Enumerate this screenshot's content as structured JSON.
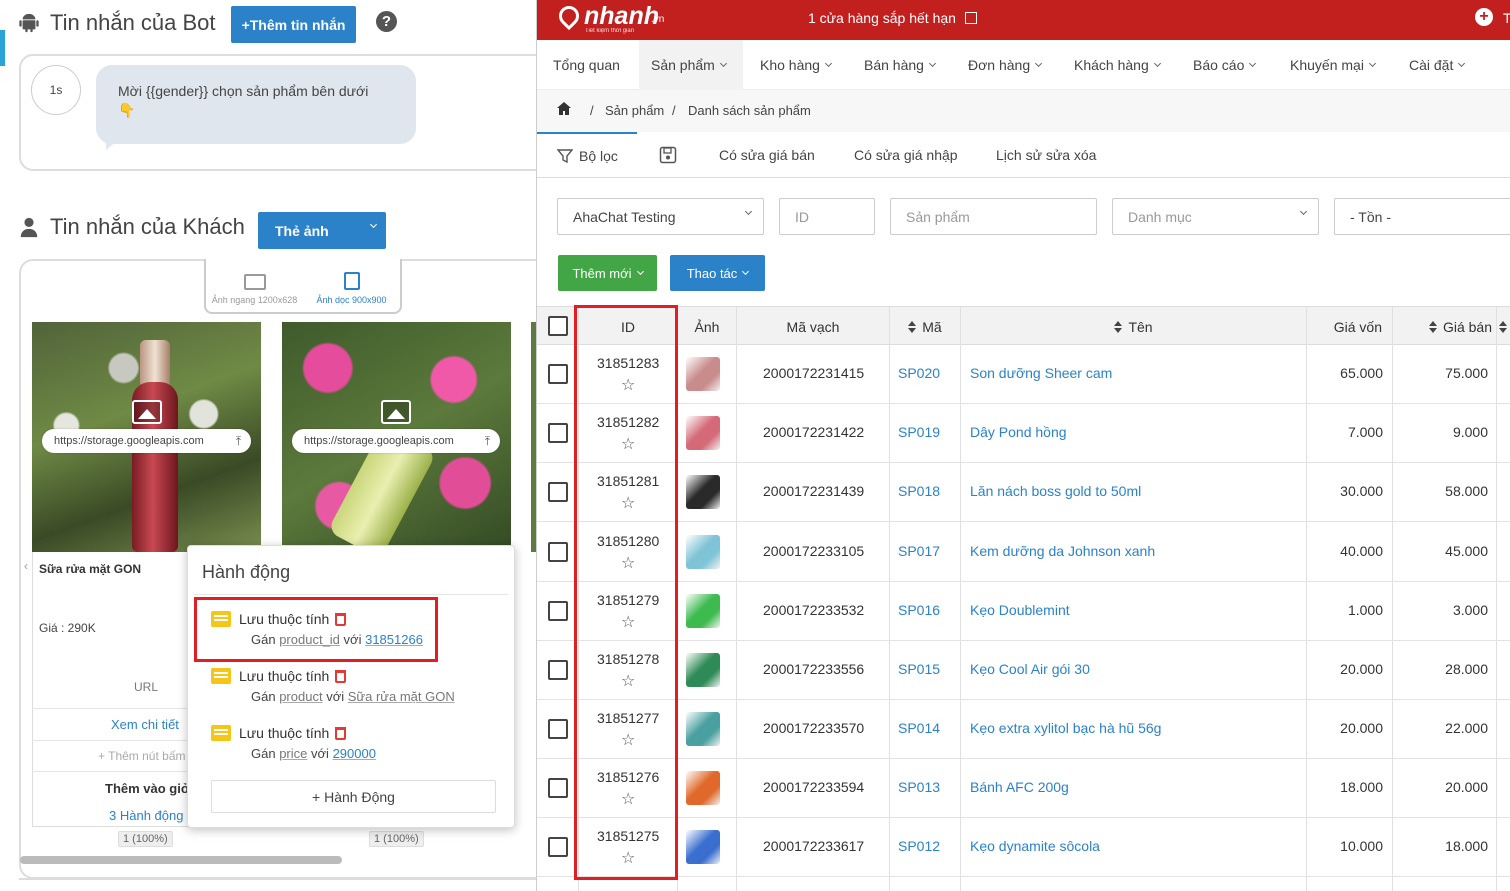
{
  "left": {
    "bot_section": {
      "title": "Tin nhắn của Bot",
      "add_button": "+Thêm tin nhắn",
      "help": "?",
      "delay": "1s",
      "message": "Mời {{gender}} chọn sản phẩm bên dưới",
      "emoji": "👇"
    },
    "customer_section": {
      "title": "Tin nhắn của Khách",
      "type_select": "Thẻ ảnh",
      "orientation": [
        {
          "label": "Ảnh ngang 1200x628",
          "active": false
        },
        {
          "label": "Ảnh dọc 900x900",
          "active": true
        }
      ],
      "cards": [
        {
          "url": "https://storage.googleapis.com",
          "name": "Sữa rửa mặt GON",
          "price": "Giá : 290K",
          "url_label": "URL",
          "link": "Xem chi tiết",
          "add_button": "+ Thêm nút bấm",
          "cart": "Thêm vào giỏ",
          "actions": "3 Hành động",
          "stat": "1 (100%)"
        },
        {
          "url": "https://storage.googleapis.com",
          "stat": "1 (100%)"
        }
      ]
    },
    "popup": {
      "title": "Hành động",
      "actions": [
        {
          "label": "Lưu thuộc tính",
          "prefix": "Gán",
          "attr": "product_id",
          "joiner": "với",
          "value": "31851266"
        },
        {
          "label": "Lưu thuộc tính",
          "prefix": "Gán",
          "attr": "product",
          "joiner": "với",
          "value": "Sữa rửa mặt GON"
        },
        {
          "label": "Lưu thuộc tính",
          "prefix": "Gán",
          "attr": "price",
          "joiner": "với",
          "value": "290000"
        }
      ],
      "add_button": "+ Hành Động"
    }
  },
  "right": {
    "brand": {
      "name": "nhanh",
      "tld": ".vn",
      "tagline": "Tiết kiệm thời gian"
    },
    "notice": "1 cửa hàng sắp hết hạn",
    "header_right": "T",
    "nav": [
      "Tổng quan",
      "Sản phẩm",
      "Kho hàng",
      "Bán hàng",
      "Đơn hàng",
      "Khách hàng",
      "Báo cáo",
      "Khuyến mại",
      "Cài đặt"
    ],
    "nav_active": "Sản phẩm",
    "breadcrumb": [
      "Sản phẩm",
      "Danh sách sản phẩm"
    ],
    "tabs": [
      "Bộ lọc",
      "Có sửa giá bán",
      "Có sửa giá nhập",
      "Lịch sử sửa xóa"
    ],
    "filters": {
      "store": "AhaChat Testing",
      "id_placeholder": "ID",
      "product_placeholder": "Sản phẩm",
      "category_placeholder": "Danh mục",
      "stock": "- Tồn -"
    },
    "buttons": {
      "add_new": "Thêm mới",
      "actions": "Thao tác"
    },
    "table": {
      "headers": {
        "id": "ID",
        "image": "Ảnh",
        "barcode": "Mã vạch",
        "code": "Mã",
        "name": "Tên",
        "cost": "Giá vốn",
        "price": "Giá bán"
      },
      "rows": [
        {
          "id": "31851283",
          "barcode": "2000172231415",
          "code": "SP020",
          "name": "Son dưỡng Sheer cam",
          "cost": "65.000",
          "price": "75.000",
          "thumb": "#c98c8c"
        },
        {
          "id": "31851282",
          "barcode": "2000172231422",
          "code": "SP019",
          "name": "Dây Pond hồng",
          "cost": "7.000",
          "price": "9.000",
          "thumb": "#d46a78"
        },
        {
          "id": "31851281",
          "barcode": "2000172231439",
          "code": "SP018",
          "name": "Lăn nách boss gold to 50ml",
          "cost": "30.000",
          "price": "58.000",
          "thumb": "#2a2a2a"
        },
        {
          "id": "31851280",
          "barcode": "2000172233105",
          "code": "SP017",
          "name": "Kem dưỡng da Johnson xanh",
          "cost": "40.000",
          "price": "45.000",
          "thumb": "#7fc4d6"
        },
        {
          "id": "31851279",
          "barcode": "2000172233532",
          "code": "SP016",
          "name": "Kẹo Doublemint",
          "cost": "1.000",
          "price": "3.000",
          "thumb": "#3dbb4f"
        },
        {
          "id": "31851278",
          "barcode": "2000172233556",
          "code": "SP015",
          "name": "Kẹo Cool Air gói 30",
          "cost": "20.000",
          "price": "28.000",
          "thumb": "#2e8b57"
        },
        {
          "id": "31851277",
          "barcode": "2000172233570",
          "code": "SP014",
          "name": "Kẹo extra xylitol bạc hà hũ 56g",
          "cost": "20.000",
          "price": "22.000",
          "thumb": "#4aa0a0"
        },
        {
          "id": "31851276",
          "barcode": "2000172233594",
          "code": "SP013",
          "name": "Bánh AFC 200g",
          "cost": "18.000",
          "price": "20.000",
          "thumb": "#e0682a"
        },
        {
          "id": "31851275",
          "barcode": "2000172233617",
          "code": "SP012",
          "name": "Kẹo dynamite sôcola",
          "cost": "10.000",
          "price": "18.000",
          "thumb": "#3a6fd0"
        }
      ]
    }
  },
  "colors": {
    "brand_red": "#c21f1f",
    "link_blue": "#2b82c9",
    "green": "#43a646",
    "highlight_red": "#e21d24"
  }
}
